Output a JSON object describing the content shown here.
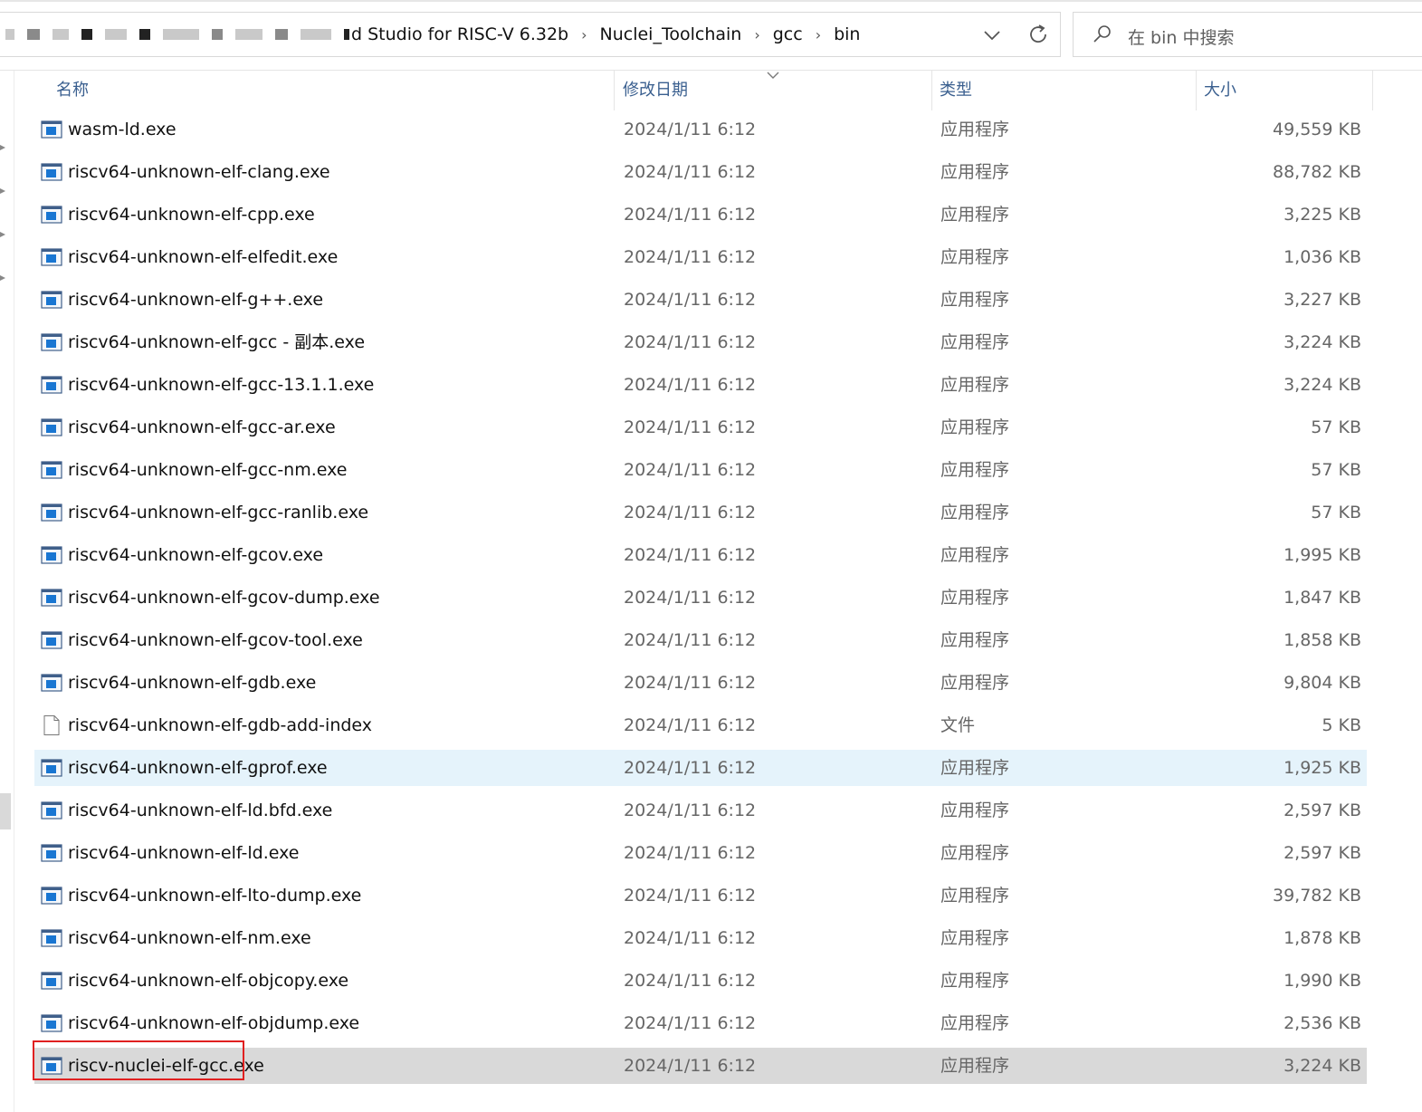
{
  "address": {
    "breadcrumb_visible_start": "d Studio for RISC-V 6.32b",
    "breadcrumbs": [
      "Nuclei_Toolchain",
      "gcc",
      "bin"
    ],
    "separator": "›"
  },
  "search": {
    "placeholder": "在 bin 中搜索"
  },
  "columns": {
    "name": "名称",
    "date": "修改日期",
    "type": "类型",
    "size": "大小"
  },
  "files": [
    {
      "name": "wasm-ld.exe",
      "date": "2024/1/11 6:12",
      "type": "应用程序",
      "size": "49,559 KB",
      "icon": "application-icon"
    },
    {
      "name": "riscv64-unknown-elf-clang.exe",
      "date": "2024/1/11 6:12",
      "type": "应用程序",
      "size": "88,782 KB",
      "icon": "application-icon"
    },
    {
      "name": "riscv64-unknown-elf-cpp.exe",
      "date": "2024/1/11 6:12",
      "type": "应用程序",
      "size": "3,225 KB",
      "icon": "application-icon"
    },
    {
      "name": "riscv64-unknown-elf-elfedit.exe",
      "date": "2024/1/11 6:12",
      "type": "应用程序",
      "size": "1,036 KB",
      "icon": "application-icon"
    },
    {
      "name": "riscv64-unknown-elf-g++.exe",
      "date": "2024/1/11 6:12",
      "type": "应用程序",
      "size": "3,227 KB",
      "icon": "application-icon"
    },
    {
      "name": "riscv64-unknown-elf-gcc - 副本.exe",
      "date": "2024/1/11 6:12",
      "type": "应用程序",
      "size": "3,224 KB",
      "icon": "application-icon"
    },
    {
      "name": "riscv64-unknown-elf-gcc-13.1.1.exe",
      "date": "2024/1/11 6:12",
      "type": "应用程序",
      "size": "3,224 KB",
      "icon": "application-icon"
    },
    {
      "name": "riscv64-unknown-elf-gcc-ar.exe",
      "date": "2024/1/11 6:12",
      "type": "应用程序",
      "size": "57 KB",
      "icon": "application-icon"
    },
    {
      "name": "riscv64-unknown-elf-gcc-nm.exe",
      "date": "2024/1/11 6:12",
      "type": "应用程序",
      "size": "57 KB",
      "icon": "application-icon"
    },
    {
      "name": "riscv64-unknown-elf-gcc-ranlib.exe",
      "date": "2024/1/11 6:12",
      "type": "应用程序",
      "size": "57 KB",
      "icon": "application-icon"
    },
    {
      "name": "riscv64-unknown-elf-gcov.exe",
      "date": "2024/1/11 6:12",
      "type": "应用程序",
      "size": "1,995 KB",
      "icon": "application-icon"
    },
    {
      "name": "riscv64-unknown-elf-gcov-dump.exe",
      "date": "2024/1/11 6:12",
      "type": "应用程序",
      "size": "1,847 KB",
      "icon": "application-icon"
    },
    {
      "name": "riscv64-unknown-elf-gcov-tool.exe",
      "date": "2024/1/11 6:12",
      "type": "应用程序",
      "size": "1,858 KB",
      "icon": "application-icon"
    },
    {
      "name": "riscv64-unknown-elf-gdb.exe",
      "date": "2024/1/11 6:12",
      "type": "应用程序",
      "size": "9,804 KB",
      "icon": "application-icon"
    },
    {
      "name": "riscv64-unknown-elf-gdb-add-index",
      "date": "2024/1/11 6:12",
      "type": "文件",
      "size": "5 KB",
      "icon": "file-icon"
    },
    {
      "name": "riscv64-unknown-elf-gprof.exe",
      "date": "2024/1/11 6:12",
      "type": "应用程序",
      "size": "1,925 KB",
      "icon": "application-icon",
      "state": "hover"
    },
    {
      "name": "riscv64-unknown-elf-ld.bfd.exe",
      "date": "2024/1/11 6:12",
      "type": "应用程序",
      "size": "2,597 KB",
      "icon": "application-icon"
    },
    {
      "name": "riscv64-unknown-elf-ld.exe",
      "date": "2024/1/11 6:12",
      "type": "应用程序",
      "size": "2,597 KB",
      "icon": "application-icon"
    },
    {
      "name": "riscv64-unknown-elf-lto-dump.exe",
      "date": "2024/1/11 6:12",
      "type": "应用程序",
      "size": "39,782 KB",
      "icon": "application-icon"
    },
    {
      "name": "riscv64-unknown-elf-nm.exe",
      "date": "2024/1/11 6:12",
      "type": "应用程序",
      "size": "1,878 KB",
      "icon": "application-icon"
    },
    {
      "name": "riscv64-unknown-elf-objcopy.exe",
      "date": "2024/1/11 6:12",
      "type": "应用程序",
      "size": "1,990 KB",
      "icon": "application-icon"
    },
    {
      "name": "riscv64-unknown-elf-objdump.exe",
      "date": "2024/1/11 6:12",
      "type": "应用程序",
      "size": "2,536 KB",
      "icon": "application-icon"
    },
    {
      "name": "riscv-nuclei-elf-gcc.exe",
      "date": "2024/1/11 6:12",
      "type": "应用程序",
      "size": "3,224 KB",
      "icon": "application-icon",
      "state": "selected"
    }
  ],
  "colors": {
    "header_text": "#3a5f8f",
    "hover_row": "#e5f3fb",
    "selected_row": "#d9d9d9",
    "annotation_box": "#e02020"
  }
}
